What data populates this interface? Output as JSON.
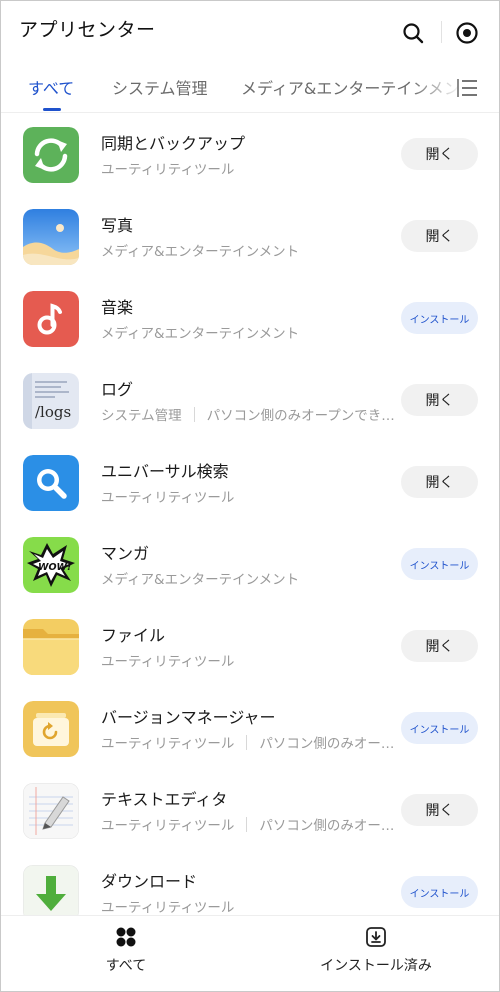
{
  "header": {
    "title": "アプリセンター",
    "search_icon": "search-icon",
    "target_icon": "target-icon"
  },
  "tabs": [
    {
      "label": "すべて",
      "active": true
    },
    {
      "label": "システム管理",
      "active": false
    },
    {
      "label": "メディア&エンターテインメント",
      "active": false
    }
  ],
  "accent_color": "#1f52cc",
  "apps": [
    {
      "name": "同期とバックアップ",
      "category": "ユーティリティツール",
      "extra": "",
      "action": "開く",
      "action_type": "open",
      "icon": "sync-icon"
    },
    {
      "name": "写真",
      "category": "メディア&エンターテインメント",
      "extra": "",
      "action": "開く",
      "action_type": "open",
      "icon": "photos-icon"
    },
    {
      "name": "音楽",
      "category": "メディア&エンターテインメント",
      "extra": "",
      "action": "インストール",
      "action_type": "install",
      "icon": "music-icon"
    },
    {
      "name": "ログ",
      "category": "システム管理",
      "extra": "パソコン側のみオープンでき…",
      "action": "開く",
      "action_type": "open",
      "icon": "logs-icon",
      "icon_text": "/logs"
    },
    {
      "name": "ユニバーサル検索",
      "category": "ユーティリティツール",
      "extra": "",
      "action": "開く",
      "action_type": "open",
      "icon": "universal-search-icon"
    },
    {
      "name": "マンガ",
      "category": "メディア&エンターテインメント",
      "extra": "",
      "action": "インストール",
      "action_type": "install",
      "icon": "manga-icon",
      "icon_text": "WOW!"
    },
    {
      "name": "ファイル",
      "category": "ユーティリティツール",
      "extra": "",
      "action": "開く",
      "action_type": "open",
      "icon": "folder-icon"
    },
    {
      "name": "バージョンマネージャー",
      "category": "ユーティリティツール",
      "extra": "パソコン側のみオー…",
      "action": "インストール",
      "action_type": "install",
      "icon": "version-manager-icon"
    },
    {
      "name": "テキストエディタ",
      "category": "ユーティリティツール",
      "extra": "パソコン側のみオー…",
      "action": "開く",
      "action_type": "open",
      "icon": "text-editor-icon"
    },
    {
      "name": "ダウンロード",
      "category": "ユーティリティツール",
      "extra": "",
      "action": "インストール",
      "action_type": "install",
      "icon": "download-icon"
    }
  ],
  "bottom_nav": [
    {
      "label": "すべて",
      "icon": "grid-icon"
    },
    {
      "label": "インストール済み",
      "icon": "installed-icon"
    }
  ]
}
